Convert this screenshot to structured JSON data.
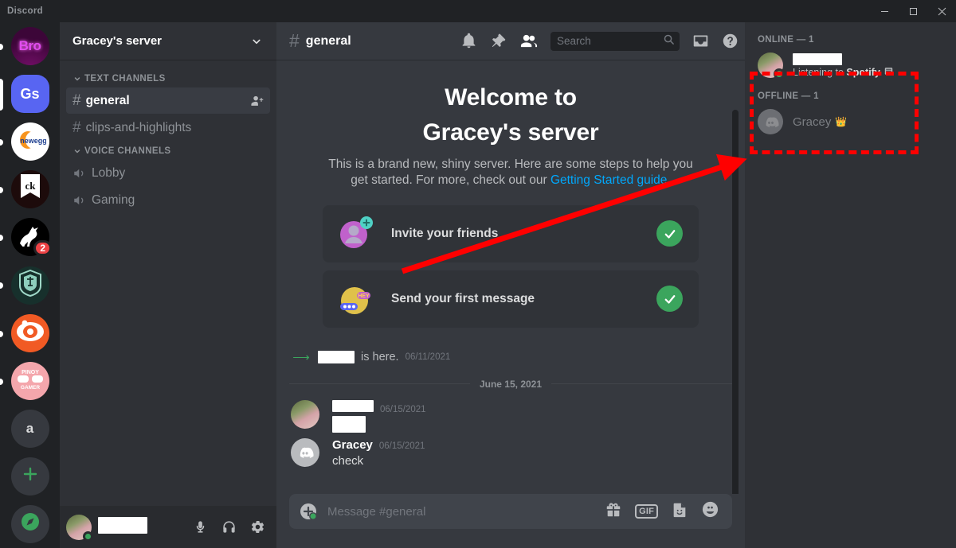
{
  "window": {
    "title": "Discord",
    "minimize_label": "Minimize",
    "maximize_label": "Maximize",
    "close_label": "Close"
  },
  "server_rail": {
    "servers": [
      {
        "name": "Bro",
        "initials": "Bro",
        "kind": "bro",
        "state": "unread",
        "badge": ""
      },
      {
        "name": "Gracey's server",
        "initials": "Gs",
        "kind": "gs",
        "state": "selected",
        "badge": ""
      },
      {
        "name": "Newegg",
        "initials": "",
        "kind": "newegg",
        "state": "unread",
        "badge": ""
      },
      {
        "name": "CK",
        "initials": "",
        "kind": "ck",
        "state": "unread",
        "badge": ""
      },
      {
        "name": "Horse",
        "initials": "",
        "kind": "horse",
        "state": "unread",
        "badge": "2"
      },
      {
        "name": "World of Warships",
        "initials": "",
        "kind": "wows",
        "state": "unread",
        "badge": ""
      },
      {
        "name": "SteelSeries",
        "initials": "",
        "kind": "steel",
        "state": "unread",
        "badge": ""
      },
      {
        "name": "Pinoy Gamer",
        "initials": "",
        "kind": "pinoy",
        "state": "unread",
        "badge": ""
      },
      {
        "name": "a",
        "initials": "a",
        "kind": "a",
        "state": "none",
        "badge": ""
      },
      {
        "name": "Add a Server",
        "initials": "+",
        "kind": "add",
        "state": "none",
        "badge": ""
      },
      {
        "name": "Explore Public Servers",
        "initials": "",
        "kind": "explore",
        "state": "none",
        "badge": ""
      }
    ]
  },
  "sidebar": {
    "guild_name": "Gracey's server",
    "categories": [
      {
        "label": "TEXT CHANNELS",
        "type": "text",
        "channels": [
          {
            "name": "general",
            "active": true,
            "has_invite_action": true
          },
          {
            "name": "clips-and-highlights",
            "active": false,
            "has_invite_action": false
          }
        ]
      },
      {
        "label": "VOICE CHANNELS",
        "type": "voice",
        "channels": [
          {
            "name": "Lobby",
            "active": false,
            "has_invite_action": false
          },
          {
            "name": "Gaming",
            "active": false,
            "has_invite_action": false
          }
        ]
      }
    ]
  },
  "user_panel": {
    "username": "",
    "username_redacted": true,
    "status": "online",
    "mute_label": "Mute",
    "deafen_label": "Deafen",
    "settings_label": "User Settings"
  },
  "chat": {
    "channel_name": "general",
    "channel_hash": "#",
    "toolbar": {
      "notifications_label": "Notification Settings",
      "pinned_label": "Pinned Messages",
      "members_label": "Member List",
      "inbox_label": "Inbox",
      "help_label": "Help"
    },
    "search": {
      "placeholder": "Search",
      "value": ""
    },
    "welcome": {
      "line1": "Welcome to",
      "line2": "Gracey's server",
      "description_part1": "This is a brand new, shiny server. Here are some steps to help you get started. For more, check out our ",
      "link_text": "Getting Started guide",
      "description_part2": "."
    },
    "cards": [
      {
        "label": "Invite your friends",
        "icon": "invite-friends-icon",
        "completed": true
      },
      {
        "label": "Send your first message",
        "icon": "send-message-icon",
        "completed": true
      }
    ],
    "join_message": {
      "username": "",
      "username_redacted": true,
      "text": "is here.",
      "timestamp": "06/11/2021"
    },
    "date_divider": "June 15, 2021",
    "messages": [
      {
        "author": "",
        "author_redacted": true,
        "timestamp": "06/15/2021",
        "text": "",
        "text_redacted": true,
        "avatar": "photo"
      },
      {
        "author": "Gracey",
        "author_redacted": false,
        "timestamp": "06/15/2021",
        "text": "check",
        "text_redacted": false,
        "avatar": "discord"
      }
    ],
    "composer": {
      "placeholder": "Message #general",
      "value": "",
      "upload_label": "Upload a File",
      "gift_label": "Gift Nitro",
      "gif_label": "GIF",
      "sticker_label": "Sticker",
      "emoji_label": "Emoji"
    }
  },
  "members": {
    "groups": [
      {
        "heading": "ONLINE — 1",
        "items": [
          {
            "name": "",
            "name_redacted": true,
            "activity": "Listening to Spotify",
            "status": "online",
            "avatar": "photo",
            "crown": false
          }
        ]
      },
      {
        "heading": "OFFLINE — 1",
        "items": [
          {
            "name": "Gracey",
            "name_redacted": false,
            "activity": "",
            "status": "offline",
            "avatar": "discord",
            "crown": true,
            "crown_glyph": "👑"
          }
        ]
      }
    ]
  },
  "annotations": {
    "highlight_color": "#ff0000",
    "box_label": "member-list-highlight",
    "arrow_label": "pointer-arrow"
  }
}
